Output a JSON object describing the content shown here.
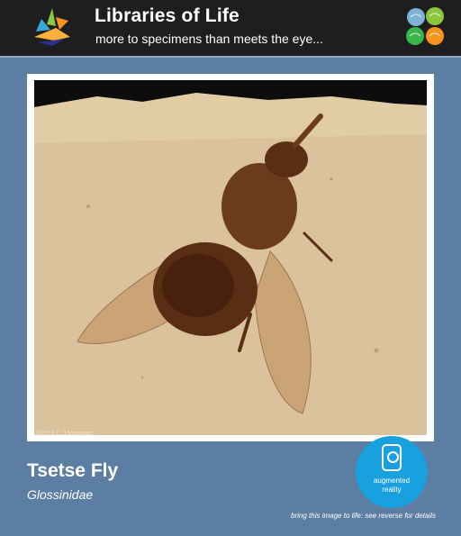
{
  "header": {
    "title": "Libraries of Life",
    "subtitle": "more to specimens than meets the eye...",
    "left_logo_icon": "leaf-bird-logo-icon",
    "right_logo_icon": "four-petal-logo-icon"
  },
  "card": {
    "copyright": "©2016 C.J.Mowman",
    "specimen_name": "Tsetse Fly",
    "specimen_family": "Glossinidae"
  },
  "ar_badge": {
    "icon": "phone-icon",
    "line1": "augmented",
    "line2": "reality"
  },
  "footer": {
    "note": "bring this image to life: see reverse for details"
  },
  "colors": {
    "background": "#5d7ea3",
    "header": "#1e1e1e",
    "badge": "#19a0df",
    "stone": "#d9c29c",
    "fossil": "#6b3b1e"
  }
}
